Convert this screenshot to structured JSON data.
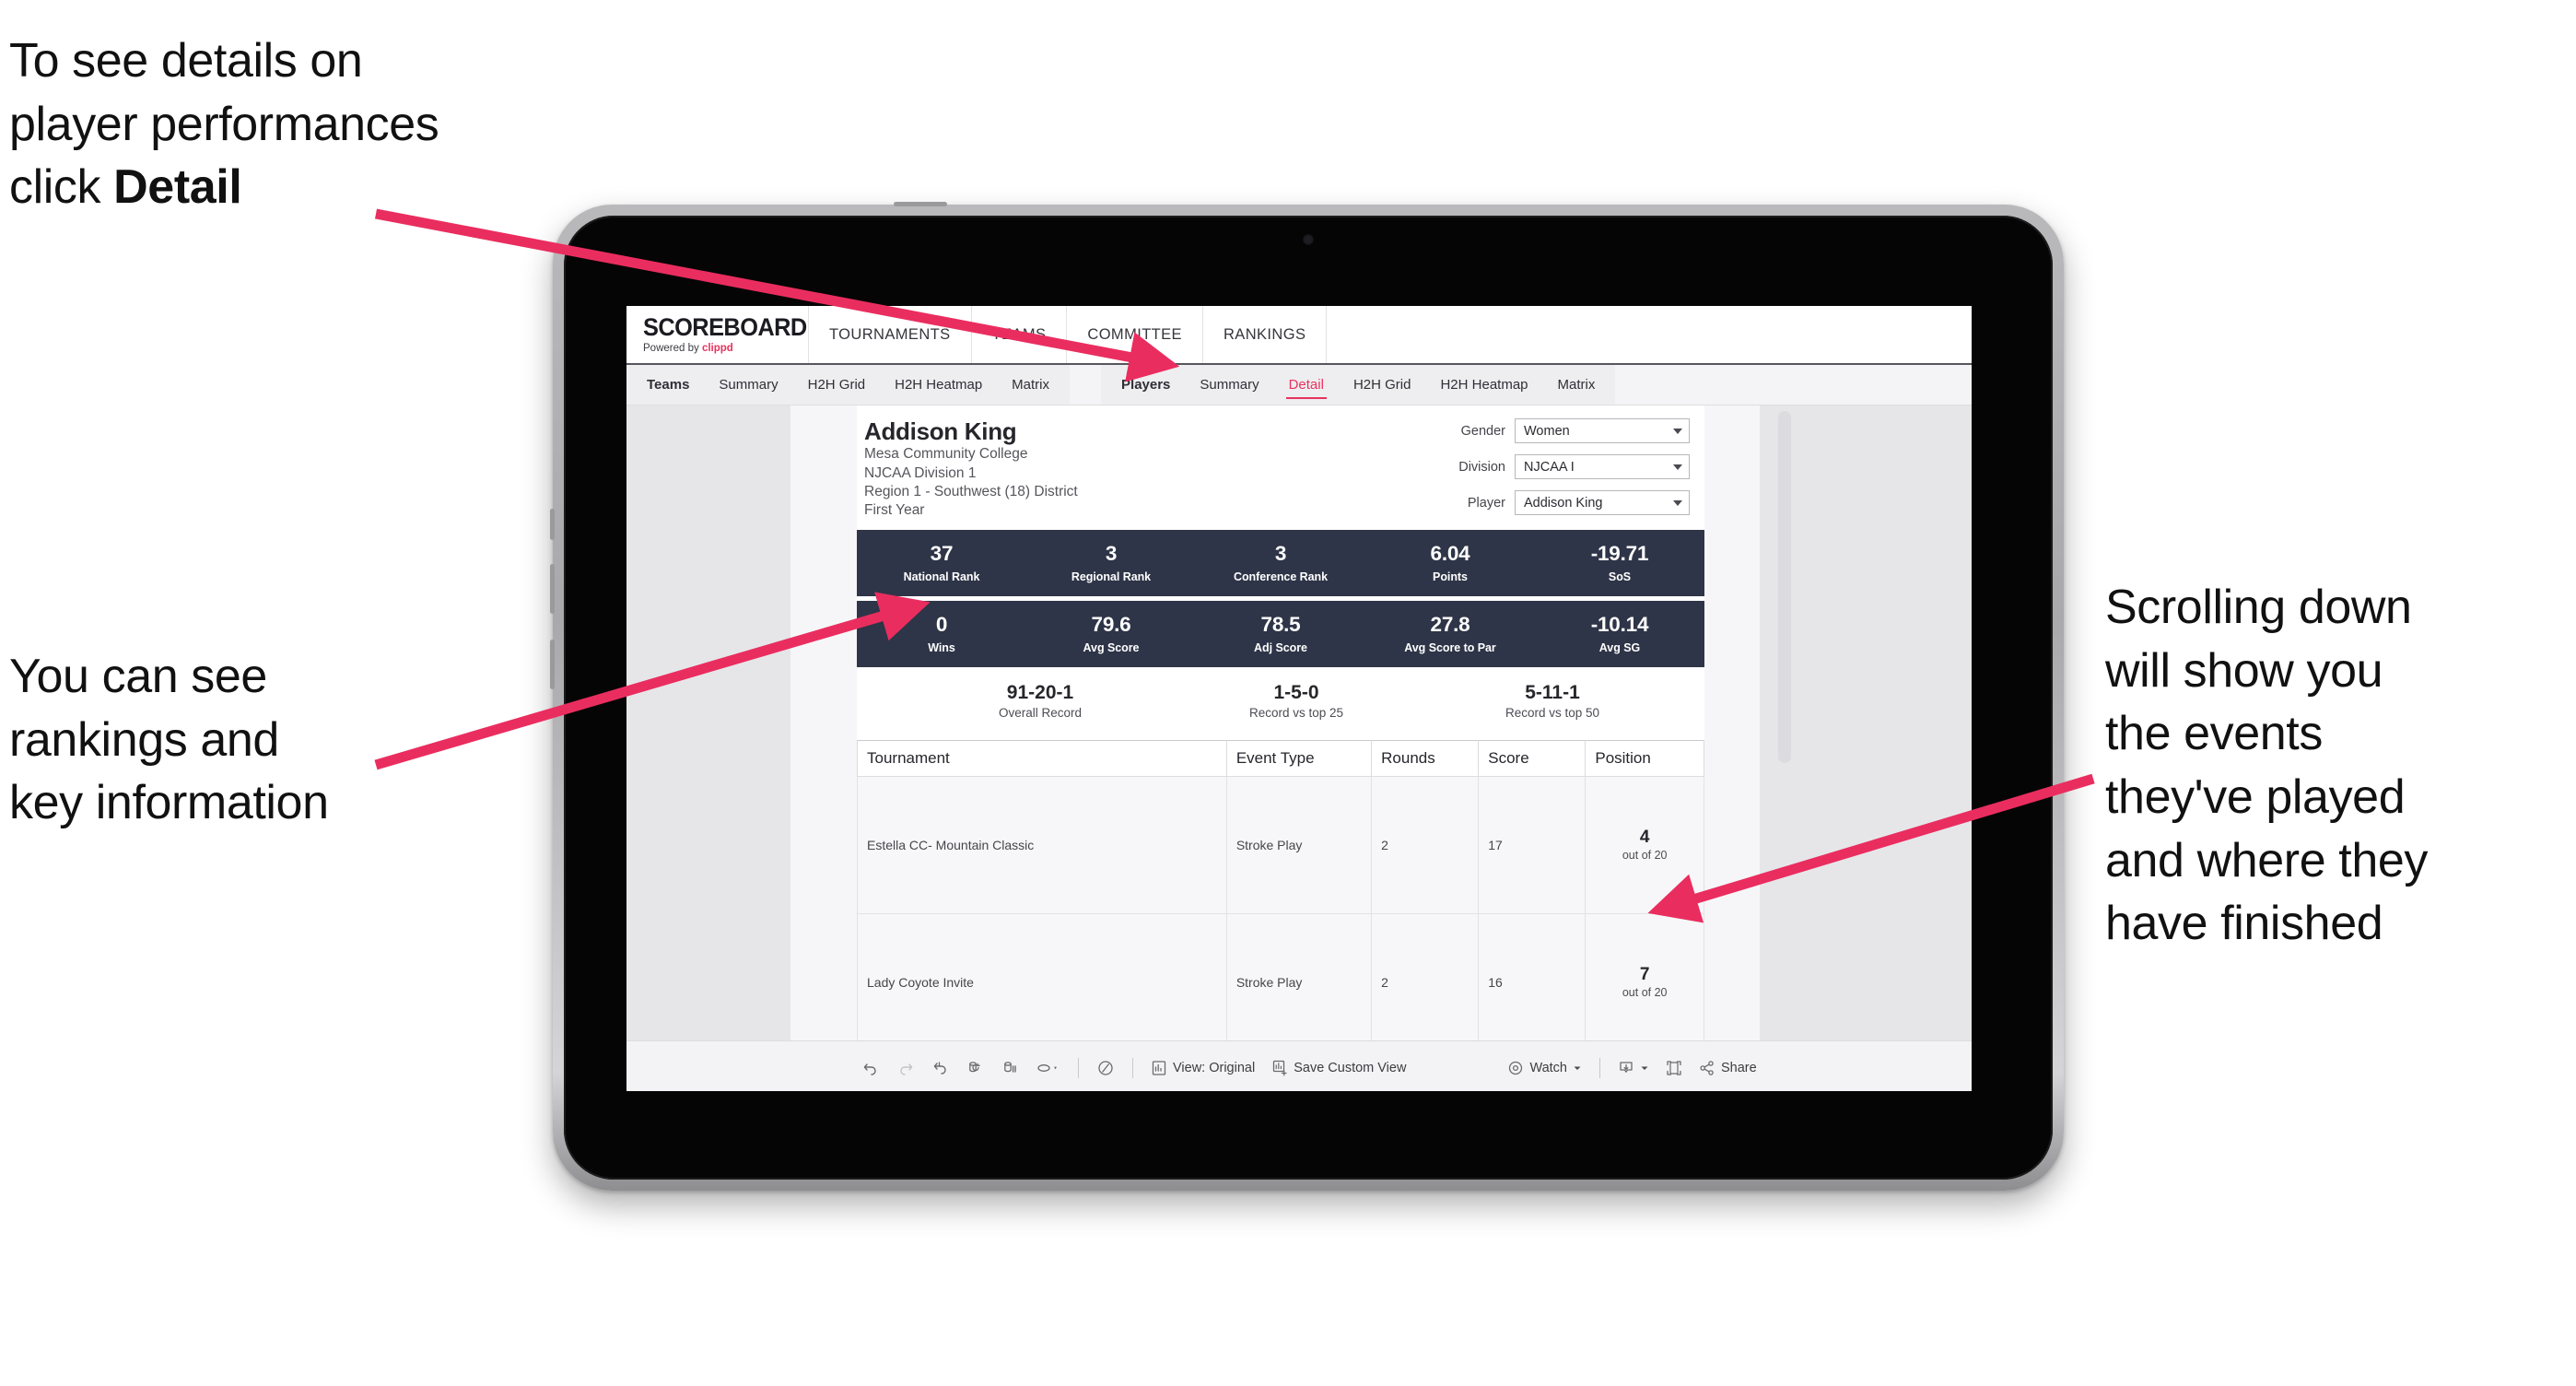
{
  "annotations": {
    "top_left": "To see details on\nplayer performances\nclick ",
    "top_left_bold": "Detail",
    "left": "You can see\nrankings and\nkey information",
    "right": "Scrolling down\nwill show you\nthe events\nthey've played\nand where they\nhave finished",
    "arrow_color": "#ea2d5f"
  },
  "app": {
    "brand": {
      "title": "SCOREBOARD",
      "powered_prefix": "Powered by ",
      "powered_name": "clippd"
    },
    "nav": [
      {
        "label": "TOURNAMENTS"
      },
      {
        "label": "TEAMS"
      },
      {
        "label": "COMMITTEE"
      },
      {
        "label": "RANKINGS"
      }
    ],
    "tabs_teams": {
      "lead": "Teams",
      "items": [
        {
          "label": "Summary",
          "active": false
        },
        {
          "label": "H2H Grid",
          "active": false
        },
        {
          "label": "H2H Heatmap",
          "active": false
        },
        {
          "label": "Matrix",
          "active": false
        }
      ]
    },
    "tabs_players": {
      "lead": "Players",
      "items": [
        {
          "label": "Summary",
          "active": false
        },
        {
          "label": "Detail",
          "active": true
        },
        {
          "label": "H2H Grid",
          "active": false
        },
        {
          "label": "H2H Heatmap",
          "active": false
        },
        {
          "label": "Matrix",
          "active": false
        }
      ]
    },
    "accent_color": "#e8325e",
    "kpi_bar_color": "#2f3548"
  },
  "player": {
    "name": "Addison King",
    "school": "Mesa Community College",
    "division": "NJCAA Division 1",
    "region": "Region 1 - Southwest (18) District",
    "year": "First Year"
  },
  "filters": [
    {
      "label": "Gender",
      "value": "Women"
    },
    {
      "label": "Division",
      "value": "NJCAA I"
    },
    {
      "label": "Player",
      "value": "Addison King"
    }
  ],
  "kpis_row1": [
    {
      "value": "37",
      "label": "National Rank"
    },
    {
      "value": "3",
      "label": "Regional Rank"
    },
    {
      "value": "3",
      "label": "Conference Rank"
    },
    {
      "value": "6.04",
      "label": "Points"
    },
    {
      "value": "-19.71",
      "label": "SoS"
    }
  ],
  "kpis_row2": [
    {
      "value": "0",
      "label": "Wins"
    },
    {
      "value": "79.6",
      "label": "Avg Score"
    },
    {
      "value": "78.5",
      "label": "Adj Score"
    },
    {
      "value": "27.8",
      "label": "Avg Score to Par"
    },
    {
      "value": "-10.14",
      "label": "Avg SG"
    }
  ],
  "records": [
    {
      "value": "91-20-1",
      "label": "Overall Record"
    },
    {
      "value": "1-5-0",
      "label": "Record vs top 25"
    },
    {
      "value": "5-11-1",
      "label": "Record vs top 50"
    }
  ],
  "tournament_table": {
    "headers": [
      "Tournament",
      "Event Type",
      "Rounds",
      "Score",
      "Position"
    ],
    "rows": [
      {
        "tournament": "Estella CC- Mountain Classic",
        "event_type": "Stroke Play",
        "rounds": "2",
        "score": "17",
        "position": "4",
        "position_of": "out of 20"
      },
      {
        "tournament": "Lady Coyote Invite",
        "event_type": "Stroke Play",
        "rounds": "2",
        "score": "16",
        "position": "7",
        "position_of": "out of 20"
      }
    ]
  },
  "toolbar": {
    "view_original": "View: Original",
    "save_custom_view": "Save Custom View",
    "watch": "Watch",
    "share": "Share"
  }
}
